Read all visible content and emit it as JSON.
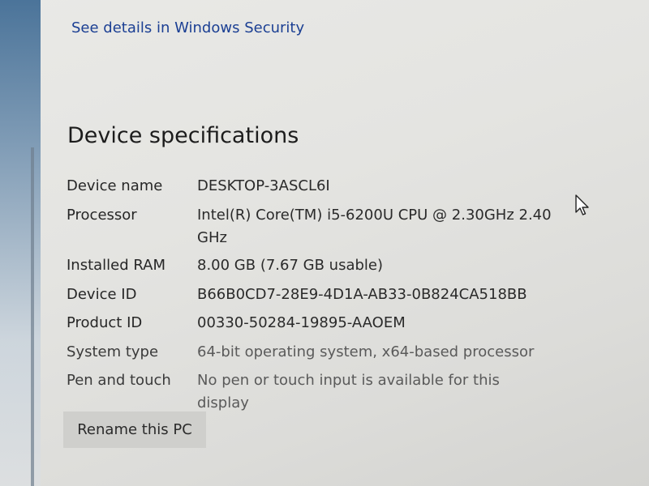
{
  "security_link": "See details in Windows Security",
  "device_specs": {
    "title": "Device specifications",
    "rows": [
      {
        "label": "Device name",
        "value": "DESKTOP-3ASCL6I"
      },
      {
        "label": "Processor",
        "value": "Intel(R) Core(TM) i5-6200U CPU @ 2.30GHz   2.40 GHz"
      },
      {
        "label": "Installed RAM",
        "value": "8.00 GB (7.67 GB usable)"
      },
      {
        "label": "Device ID",
        "value": "B66B0CD7-28E9-4D1A-AB33-0B824CA518BB"
      },
      {
        "label": "Product ID",
        "value": "00330-50284-19895-AAOEM"
      },
      {
        "label": "System type",
        "value": "64-bit operating system, x64-based processor"
      },
      {
        "label": "Pen and touch",
        "value": "No pen or touch input is available for this display"
      }
    ]
  },
  "rename_button": "Rename this PC",
  "icons": {
    "cursor": "mouse-pointer-icon"
  }
}
